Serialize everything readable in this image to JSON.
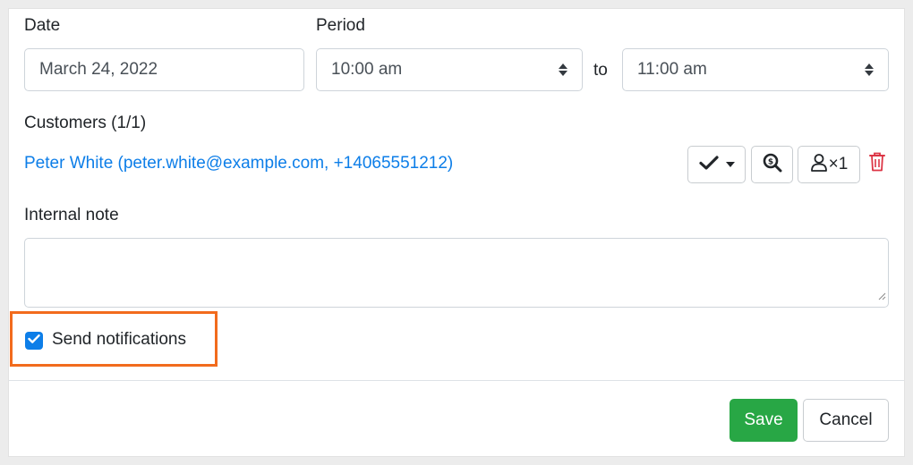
{
  "form": {
    "date_label": "Date",
    "date_value": "March 24, 2022",
    "period_label": "Period",
    "period_start": "10:00 am",
    "period_to": "to",
    "period_end": "11:00 am"
  },
  "customers": {
    "heading": "Customers (1/1)",
    "items": [
      {
        "text": "Peter White (peter.white@example.com, +14065551212)"
      }
    ],
    "attendees_count": "×1"
  },
  "note": {
    "label": "Internal note",
    "value": ""
  },
  "notifications": {
    "label": "Send notifications",
    "checked": true
  },
  "footer": {
    "save_label": "Save",
    "cancel_label": "Cancel"
  },
  "colors": {
    "link": "#0d7ee8",
    "primary": "#0d7ee8",
    "success": "#28a745",
    "danger": "#dc3545",
    "highlight": "#f26b1d"
  },
  "icons": {
    "status": "check-icon",
    "search": "search-dollar-icon",
    "person": "person-icon",
    "delete": "trash-icon"
  }
}
